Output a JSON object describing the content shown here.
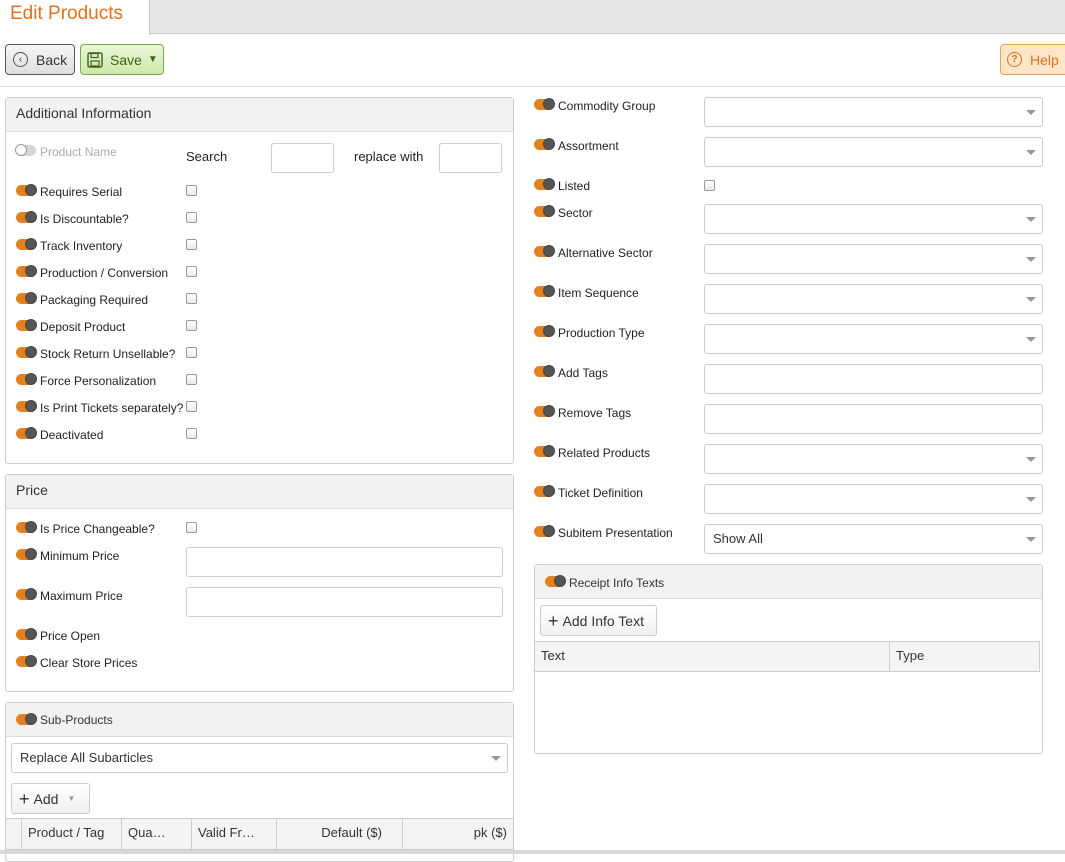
{
  "header": {
    "tab_title": "Edit Products"
  },
  "toolbar": {
    "back_label": "Back",
    "save_label": "Save",
    "help_label": "Help"
  },
  "additional_info": {
    "title": "Additional Information",
    "product_name_label": "Product Name",
    "search_label": "Search",
    "replace_label": "replace with",
    "search_value": "",
    "replace_value": "",
    "flags": [
      "Requires Serial",
      "Is Discountable?",
      "Track Inventory",
      "Production / Conversion",
      "Packaging Required",
      "Deposit Product",
      "Stock Return Unsellable?",
      "Force Personalization",
      "Is Print Tickets separately?",
      "Deactivated"
    ]
  },
  "price": {
    "title": "Price",
    "changeable_label": "Is Price Changeable?",
    "min_label": "Minimum Price",
    "max_label": "Maximum Price",
    "open_label": "Price Open",
    "clear_label": "Clear Store Prices",
    "min_value": "",
    "max_value": ""
  },
  "subproducts": {
    "title": "Sub-Products",
    "mode_value": "Replace All Subarticles",
    "add_label": "Add",
    "columns": [
      "Product / Tag",
      "Qua…",
      "Valid Fr…",
      "Default ($)",
      "pk ($)"
    ]
  },
  "right": {
    "commodity_group": "Commodity Group",
    "assortment": "Assortment",
    "listed": "Listed",
    "sector": "Sector",
    "alternative_sector": "Alternative Sector",
    "item_sequence": "Item Sequence",
    "production_type": "Production Type",
    "add_tags": "Add Tags",
    "remove_tags": "Remove Tags",
    "related_products": "Related Products",
    "ticket_definition": "Ticket Definition",
    "subitem_presentation": "Subitem Presentation",
    "subitem_presentation_value": "Show All"
  },
  "receipt": {
    "title": "Receipt Info Texts",
    "add_label": "Add Info Text",
    "columns": [
      "Text",
      "Type"
    ]
  },
  "colors": {
    "accent": "#e2711d",
    "save_green": "#cde8ad",
    "help_bg": "#fde5c8"
  }
}
